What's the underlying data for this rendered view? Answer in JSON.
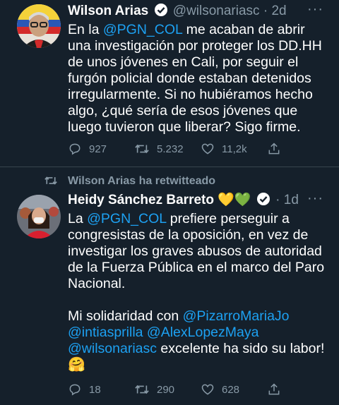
{
  "tweet1": {
    "name": "Wilson Arias",
    "handle": "@wilsonariasc",
    "time": "2d",
    "text_pre": "En la ",
    "mention1": "@PGN_COL",
    "text_post": " me acaban de abrir una investigación por proteger los DD.HH de unos jóvenes en Cali, por seguir el furgón policial donde estaban detenidos irregularmente. Si no hubiéramos hecho algo, ¿qué sería de esos jóvenes que luego tuvieron que liberar? Sigo firme.",
    "replies": "927",
    "retweets": "5.232",
    "likes": "11,2k"
  },
  "retweet_label": "Wilson Arias ha retwitteado",
  "tweet2": {
    "name": "Heidy Sánchez Barreto",
    "emojis": "💛💚",
    "time": "1d",
    "p1_pre": "La ",
    "p1_mention": "@PGN_COL",
    "p1_post": " prefiere perseguir a congresistas de la oposición, en vez de investigar los graves abusos de autoridad de la Fuerza Pública en el marco del Paro Nacional.",
    "p2_pre": "Mi solidaridad con ",
    "mention_a": "@PizarroMariaJo",
    "mention_b": "@intiasprilla",
    "mention_c": "@AlexLopezMaya",
    "mention_d": "@wilsonariasc",
    "p2_post": " excelente ha sido su labor!",
    "hug": "🤗",
    "replies": "18",
    "retweets": "290",
    "likes": "628"
  },
  "more_glyph": "···",
  "dot": "·"
}
